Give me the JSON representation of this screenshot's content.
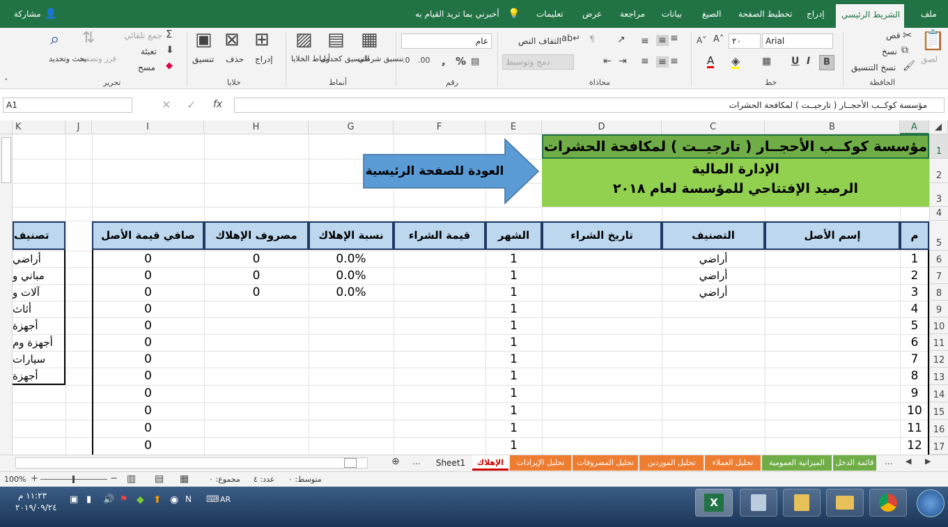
{
  "ribbon_tabs": [
    "ملف",
    "الشريط الرئيسي",
    "إدراج",
    "تخطيط الصفحة",
    "الصيغ",
    "بيانات",
    "مراجعة",
    "عرض",
    "تعليمات"
  ],
  "tell_me": "أخبرني بما تريد القيام به",
  "share": "مشاركة",
  "clipboard": {
    "paste": "لصق",
    "cut": "قص",
    "copy": "نسخ",
    "format_painter": "نسخ التنسيق",
    "group": "الحافظة"
  },
  "font": {
    "name": "Arial",
    "size": "٢٠",
    "group": "خط"
  },
  "alignment": {
    "wrap": "التفاف النص",
    "merge": "دمج وتوسيط",
    "group": "محاذاة"
  },
  "number": {
    "format": "عام",
    "group": "رقم"
  },
  "styles": {
    "conditional": "تنسيق شرطي",
    "as_table": "التنسيق كجدول",
    "cell_styles": "أنماط الخلايا",
    "group": "أنماط"
  },
  "cells": {
    "insert": "إدراج",
    "delete": "حذف",
    "format": "تنسيق",
    "group": "خلايا"
  },
  "editing": {
    "autosum": "جمع تلقائي",
    "fill": "تعبئة",
    "clear": "مسح",
    "sort": "فرز وتصفية",
    "find": "بحث وتحديد",
    "group": "تحرير"
  },
  "formula_bar": {
    "name_box": "A1",
    "formula": "مؤسسة كوكــب الأحجــار ( تارجيــت ) لمكافحة الحشرات"
  },
  "columns": [
    "A",
    "B",
    "C",
    "D",
    "E",
    "F",
    "G",
    "H",
    "I",
    "J",
    "K"
  ],
  "rows": [
    "1",
    "2",
    "3",
    "4",
    "5",
    "6",
    "7",
    "8",
    "9",
    "10",
    "11",
    "12",
    "13",
    "14",
    "15",
    "16",
    "17"
  ],
  "title1": "مؤسسة كوكــب الأحجــار ( تارجيــت ) لمكافحة الحشرات",
  "title2": "الإدارة المالية",
  "title3": "الرصيد الإفتتاحي للمؤسسة لعام ٢٠١٨",
  "back_arrow": "العودة للصفحة الرئيسية",
  "headers": {
    "m": "م",
    "asset": "إسم الأصل",
    "category": "التصنيف",
    "date": "تاريخ الشراء",
    "month": "الشهر",
    "price": "قيمة الشراء",
    "rate": "نسبة الإهلاك",
    "dep": "مصروف الإهلاك",
    "net": "صافي قيمة الأصل",
    "cat2": "تصنيف"
  },
  "table_rows": [
    {
      "m": "1",
      "category": "أراضي",
      "month": "1",
      "rate": "0.0%",
      "dep": "0",
      "net": "0"
    },
    {
      "m": "2",
      "category": "أراضي",
      "month": "1",
      "rate": "0.0%",
      "dep": "0",
      "net": "0"
    },
    {
      "m": "3",
      "category": "أراضي",
      "month": "1",
      "rate": "0.0%",
      "dep": "0",
      "net": "0"
    },
    {
      "m": "4",
      "category": "",
      "month": "1",
      "rate": "",
      "dep": "",
      "net": "0"
    },
    {
      "m": "5",
      "category": "",
      "month": "1",
      "rate": "",
      "dep": "",
      "net": "0"
    },
    {
      "m": "6",
      "category": "",
      "month": "1",
      "rate": "",
      "dep": "",
      "net": "0"
    },
    {
      "m": "7",
      "category": "",
      "month": "1",
      "rate": "",
      "dep": "",
      "net": "0"
    },
    {
      "m": "8",
      "category": "",
      "month": "1",
      "rate": "",
      "dep": "",
      "net": "0"
    },
    {
      "m": "9",
      "category": "",
      "month": "1",
      "rate": "",
      "dep": "",
      "net": "0"
    },
    {
      "m": "10",
      "category": "",
      "month": "1",
      "rate": "",
      "dep": "",
      "net": "0"
    },
    {
      "m": "11",
      "category": "",
      "month": "1",
      "rate": "",
      "dep": "",
      "net": "0"
    },
    {
      "m": "12",
      "category": "",
      "month": "1",
      "rate": "",
      "dep": "",
      "net": "0"
    }
  ],
  "cat_list": [
    "أراضي",
    "مباني و",
    "آلات و",
    "أثاث",
    "أجهزة",
    "أجهزة وم",
    "سيارات",
    "أجهزة"
  ],
  "sheet_tabs": [
    {
      "label": "قائمة الدخل",
      "color": "#70ad47"
    },
    {
      "label": "الميزانية العمومية",
      "color": "#70ad47"
    },
    {
      "label": "تحليل العملاء",
      "color": "#ed7d31"
    },
    {
      "label": "تحليل الموردين",
      "color": "#ed7d31"
    },
    {
      "label": "تحليل المصروفات",
      "color": "#ed7d31"
    },
    {
      "label": "تحليل الإيرادات",
      "color": "#ed7d31"
    },
    {
      "label": "الإهلاك",
      "color": "#ffffff"
    },
    {
      "label": "Sheet1",
      "color": "#f3f3f3"
    }
  ],
  "ellipsis": "...",
  "status": {
    "avg": "متوسط: ٠",
    "count": "عدد: ٤",
    "sum": "مجموع: ٠",
    "zoom": "100%"
  },
  "taskbar": {
    "time": "١١:٢٣ م",
    "date": "٢٠١٩/٠٩/٢٤",
    "lang": "AR"
  }
}
